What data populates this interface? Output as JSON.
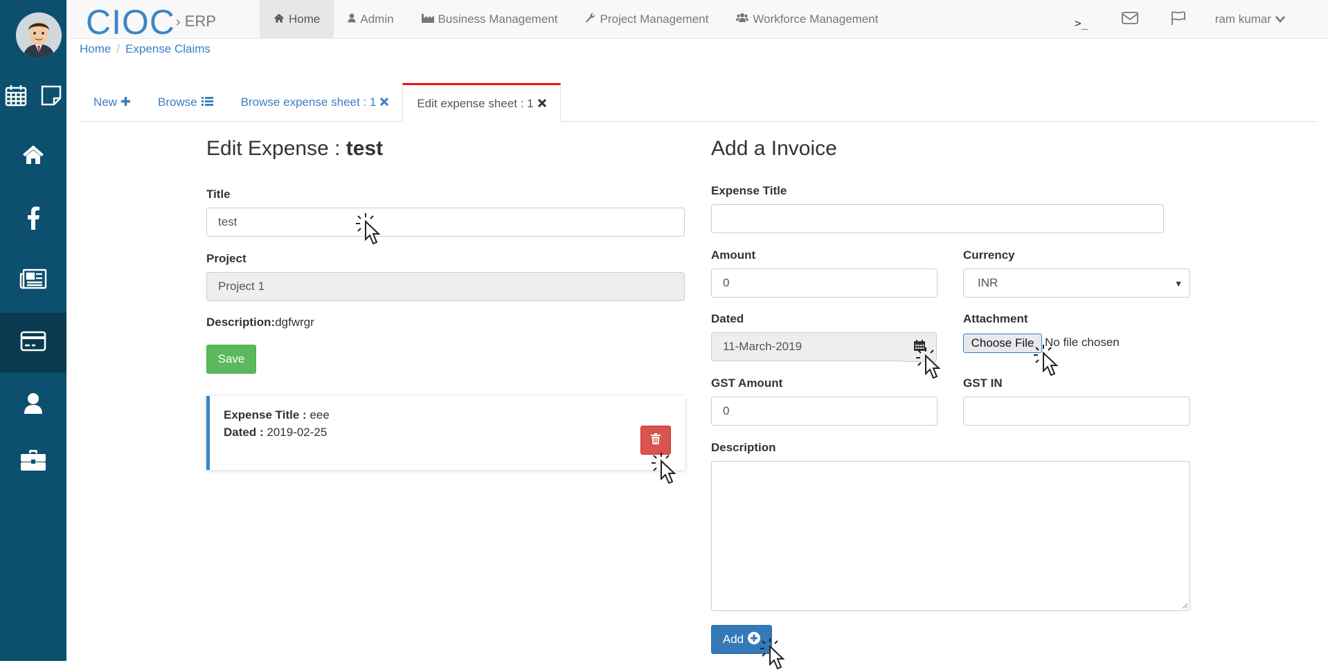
{
  "brand": {
    "name": "CIOC",
    "sub": "ERP"
  },
  "nav": {
    "home": "Home",
    "admin": "Admin",
    "business": "Business Management",
    "project": "Project Management",
    "workforce": "Workforce Management"
  },
  "user": {
    "name": "ram kumar"
  },
  "breadcrumb": {
    "home": "Home",
    "current": "Expense Claims"
  },
  "tabs": {
    "new": "New",
    "browse": "Browse",
    "browse_sheet": "Browse expense sheet : 1",
    "edit_sheet": "Edit expense sheet : 1"
  },
  "edit": {
    "heading_prefix": "Edit Expense : ",
    "heading_name": "test",
    "title_label": "Title",
    "title_value": "test",
    "project_label": "Project",
    "project_value": "Project 1",
    "description_label": "Description:",
    "description_value": "dgfwrgr",
    "save_label": "Save"
  },
  "invoice_card": {
    "title_label": "Expense Title :",
    "title_value": "eee",
    "dated_label": "Dated :",
    "dated_value": "2019-02-25"
  },
  "add_invoice": {
    "heading": "Add a Invoice",
    "expense_title_label": "Expense Title",
    "expense_title_value": "",
    "amount_label": "Amount",
    "amount_value": "0",
    "currency_label": "Currency",
    "currency_value": "INR",
    "dated_label": "Dated",
    "dated_value": "11-March-2019",
    "attachment_label": "Attachment",
    "choose_file": "Choose File",
    "no_file": "No file chosen",
    "gst_amount_label": "GST Amount",
    "gst_amount_value": "0",
    "gst_in_label": "GST IN",
    "gst_in_value": "",
    "description_label": "Description",
    "add_label": "Add"
  },
  "colors": {
    "sidebar": "#0c4f6e",
    "brand": "#3a86c6",
    "save": "#5cb85c",
    "delete": "#d9534f",
    "add": "#337ab7",
    "active_tab_border": "#e11111"
  },
  "icons": [
    "calendar-icon",
    "sticky-note-icon",
    "home-icon",
    "facebook-icon",
    "newspaper-icon",
    "credit-card-icon",
    "user-icon",
    "briefcase-icon",
    "terminal-icon",
    "envelope-icon",
    "flag-icon",
    "chevron-down-icon",
    "plus-icon",
    "list-icon",
    "close-icon",
    "trash-icon",
    "plus-circle-icon"
  ]
}
